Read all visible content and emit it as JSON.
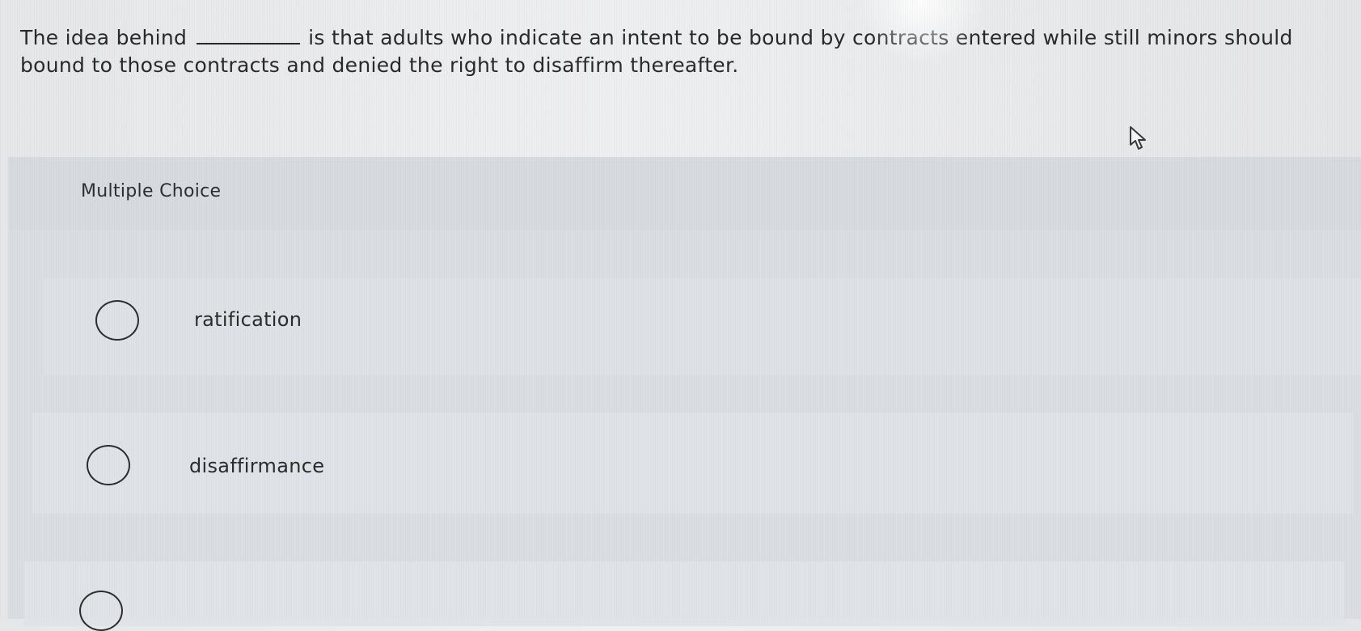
{
  "question": {
    "part_before_blank": "The idea behind",
    "part_after_blank": "is that adults who indicate an intent to be bound by contracts entered while still minors should",
    "line2": "bound to those contracts and denied the right to disaffirm thereafter."
  },
  "multiple_choice": {
    "title": "Multiple Choice",
    "options": [
      {
        "label": "ratification",
        "selected": false
      },
      {
        "label": "disaffirmance",
        "selected": false
      },
      {
        "label": "",
        "selected": false
      }
    ]
  },
  "icons": {
    "cursor": "mouse-pointer-icon",
    "radio": "radio-circle-icon"
  },
  "colors": {
    "text": "#2b2b2b",
    "panel": "#dadde2",
    "background": "#eeeff1"
  }
}
